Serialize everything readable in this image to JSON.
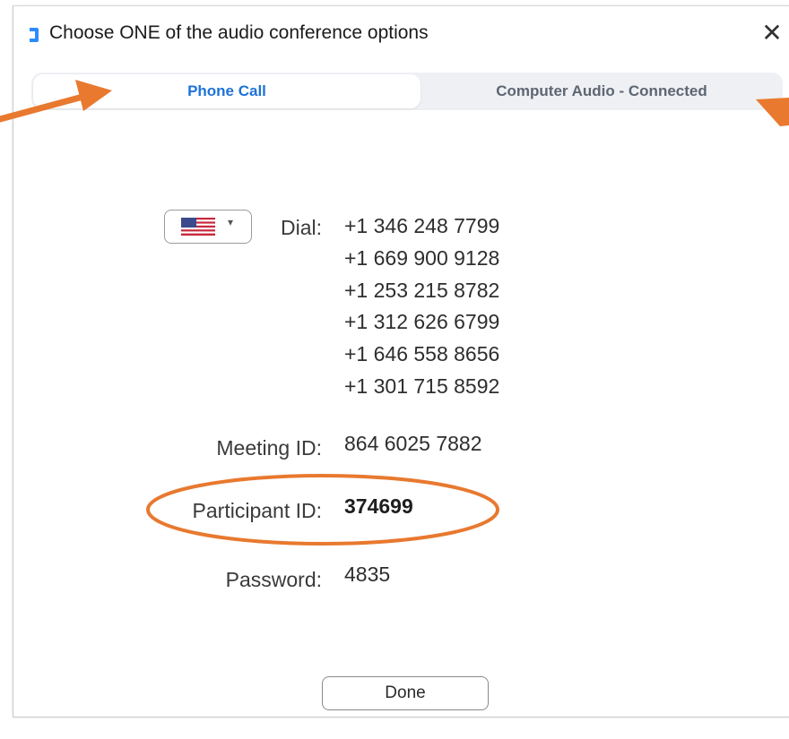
{
  "window": {
    "title": "Choose ONE of the audio conference options",
    "close_glyph": "✕",
    "app_icon": "zoom-logo-icon"
  },
  "tabs": [
    {
      "label": "Phone Call",
      "active": true
    },
    {
      "label": "Computer Audio - Connected",
      "active": false
    }
  ],
  "country_select": {
    "selected": "US flag",
    "icon": "us-flag-icon",
    "caret": "▾"
  },
  "details": {
    "dial_label": "Dial:",
    "dial_numbers": [
      "+1 346 248 7799",
      "+1 669 900 9128",
      "+1 253 215 8782",
      "+1 312 626 6799",
      "+1 646 558 8656",
      "+1 301 715 8592"
    ],
    "meeting_id_label": "Meeting ID:",
    "meeting_id": "864 6025 7882",
    "participant_id_label": "Participant ID:",
    "participant_id": "374699",
    "password_label": "Password:",
    "password": "4835"
  },
  "done_button": "Done",
  "colors": {
    "active_tab": "#1f72d8",
    "annotation": "#e8792f",
    "zoom_blue": "#2d8cff"
  }
}
